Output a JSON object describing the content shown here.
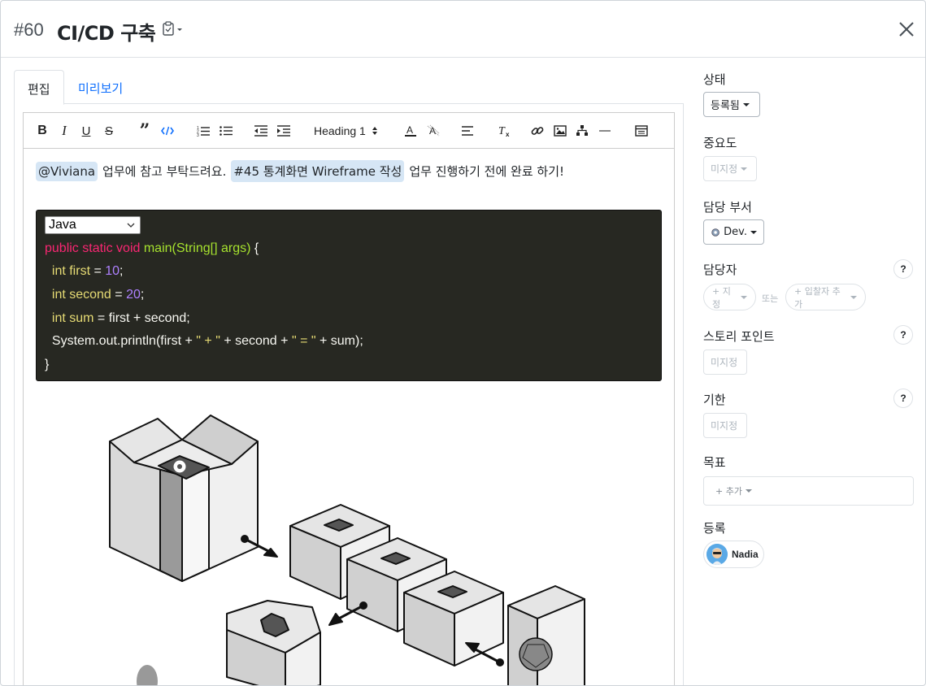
{
  "header": {
    "issue_number": "#60",
    "title": "CI/CD 구축"
  },
  "tabs": [
    {
      "label": "편집",
      "active": true
    },
    {
      "label": "미리보기",
      "active": false
    }
  ],
  "toolbar": {
    "heading_select": "Heading 1",
    "buttons": [
      "bold-icon",
      "italic-icon",
      "underline-icon",
      "strikethrough-icon",
      "blockquote-icon",
      "code-icon",
      "ordered-list-icon",
      "bullet-list-icon",
      "outdent-icon",
      "indent-icon",
      "font-color-icon",
      "highlight-icon",
      "align-left-icon",
      "clear-format-icon",
      "link-icon",
      "image-icon",
      "diagram-icon",
      "horizontal-rule-icon",
      "table-icon"
    ]
  },
  "content": {
    "mention_user": "@Viviana",
    "text1": "업무에 참고 부탁드려요.",
    "mention_issue": "#45 통계화면 Wireframe 작성",
    "text2": "업무 진행하기 전에 완료 하기!",
    "code_language": "Java",
    "code": {
      "l1_kw": "public static void",
      "l1_fn": "main(String[] args)",
      "l1_rest": " {",
      "l2_ty": "int first",
      "l2_eq": " = ",
      "l2_num": "10",
      "l2_end": ";",
      "l3_ty": "int second",
      "l3_eq": " = ",
      "l3_num": "20",
      "l3_end": ";",
      "l4_ty": "int sum",
      "l4_rest": " = first + second;",
      "l5_a": "System.out.println(first + ",
      "l5_s1": "\" + \"",
      "l5_b": " + second + ",
      "l5_s2": "\" = \"",
      "l5_c": " + sum);",
      "l6": "}"
    }
  },
  "sidebar": {
    "status_label": "상태",
    "status_value": "등록됨",
    "priority_label": "중요도",
    "priority_value": "미지정",
    "department_label": "담당 부서",
    "department_value": "Dev.",
    "assignee_label": "담당자",
    "assignee_assign": "+ 지정",
    "assignee_or": "또는",
    "assignee_add_participant": "+ 입찰자 추가",
    "story_point_label": "스토리 포인트",
    "story_point_value": "미지정",
    "due_label": "기한",
    "due_value": "미지정",
    "goal_label": "목표",
    "goal_add": "+ 추가",
    "registrant_label": "등록",
    "registrant_name": "Nadia",
    "help": "?"
  },
  "colors": {
    "mention_bg": "#d6e6f5",
    "link": "#0d6efd",
    "code_bg": "#272822",
    "keyword": "#f92672",
    "function": "#a6e22e",
    "type": "#e6db74",
    "number": "#ae81ff"
  }
}
